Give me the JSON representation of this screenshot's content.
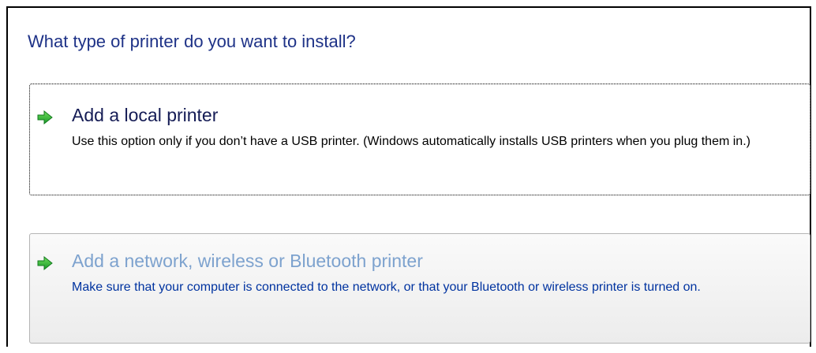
{
  "dialog": {
    "heading": "What type of printer do you want to install?"
  },
  "options": [
    {
      "title": "Add a local printer",
      "accelerator_key": "l",
      "description": "Use this option only if you don’t have a USB printer. (Windows automatically installs USB printers when you plug them in.)",
      "icon": "green-arrow-icon",
      "state": "focused"
    },
    {
      "title": "Add a network, wireless or Bluetooth printer",
      "accelerator_key": "w",
      "description": "Make sure that your computer is connected to the network, or that your Bluetooth or wireless printer is turned on.",
      "icon": "green-arrow-icon",
      "state": "hover"
    }
  ],
  "colors": {
    "heading": "#1e3287",
    "local_title": "#151c55",
    "network_title": "#7da2ce",
    "network_description": "#0033a0",
    "arrow_green": "#1aa62a"
  }
}
